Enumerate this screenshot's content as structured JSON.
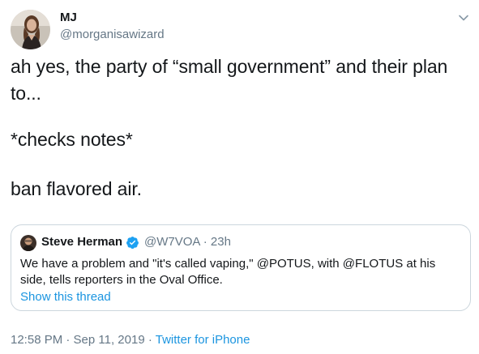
{
  "author": {
    "name": "MJ",
    "handle": "@morganisawizard",
    "avatar_icon": "profile-photo-icon"
  },
  "tweet": {
    "lines": [
      "ah yes, the party of “small government” and their plan",
      "to...",
      "*checks notes*",
      "ban flavored air."
    ]
  },
  "quote": {
    "name": "Steve Herman",
    "handle_time": "@W7VOA · 23h",
    "verified_icon": "verified-badge-icon",
    "text_lines": [
      "We have a problem and \"it's called vaping,\" @POTUS, with @FLOTUS at his",
      "side, tells reporters in the Oval Office."
    ],
    "show_thread": "Show this thread"
  },
  "meta": {
    "timestamp": "12:58 PM · Sep 11, 2019 · ",
    "source": "Twitter for iPhone"
  },
  "colors": {
    "text": "#14171a",
    "secondary": "#657786",
    "link": "#1b95e0",
    "verified": "#1da1f2",
    "border": "#ccd6dd"
  },
  "menu": {
    "caret_icon": "chevron-down-icon"
  }
}
